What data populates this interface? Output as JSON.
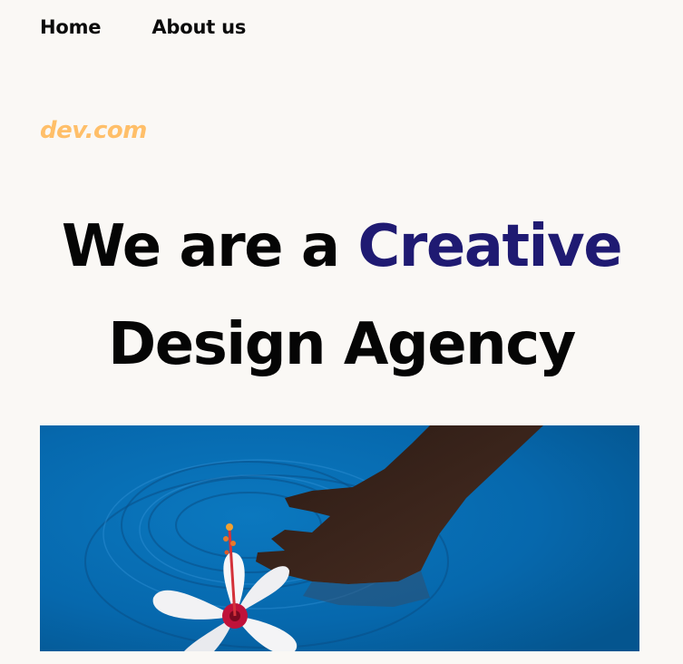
{
  "nav": {
    "items": [
      {
        "label": "Home"
      },
      {
        "label": "About us"
      }
    ]
  },
  "brand": {
    "name": "dev.com",
    "color": "#ffbf69"
  },
  "hero": {
    "headline_prefix": "We are a ",
    "headline_accent": "Creative",
    "headline_suffix": "Design Agency",
    "accent_color": "#1f1a72",
    "image": {
      "icon": "hand-with-hibiscus-flower-in-water-image"
    }
  }
}
